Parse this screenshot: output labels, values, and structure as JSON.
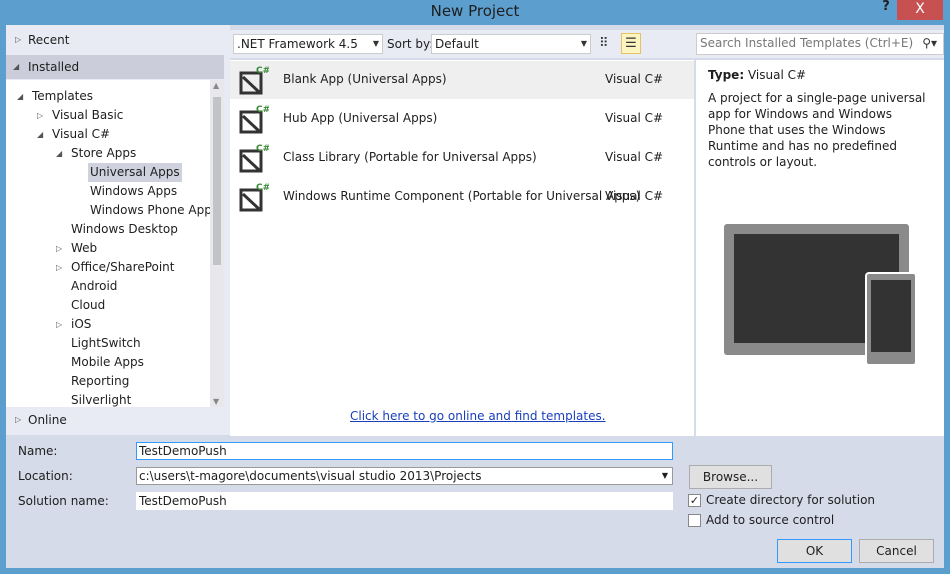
{
  "window": {
    "title": "New Project",
    "help_label": "?",
    "close_label": "X"
  },
  "left": {
    "recent": "Recent",
    "installed": "Installed",
    "online": "Online",
    "tree": [
      {
        "label": "Templates",
        "expander": "expanded"
      },
      {
        "label": "Visual Basic",
        "expander": "collapsed"
      },
      {
        "label": "Visual C#",
        "expander": "expanded"
      },
      {
        "label": "Store Apps",
        "expander": "expanded"
      },
      {
        "label": "Universal Apps",
        "selected": true
      },
      {
        "label": "Windows Apps"
      },
      {
        "label": "Windows Phone Apps"
      },
      {
        "label": "Windows Desktop"
      },
      {
        "label": "Web",
        "expander": "collapsed"
      },
      {
        "label": "Office/SharePoint",
        "expander": "collapsed"
      },
      {
        "label": "Android"
      },
      {
        "label": "Cloud"
      },
      {
        "label": "iOS",
        "expander": "collapsed"
      },
      {
        "label": "LightSwitch"
      },
      {
        "label": "Mobile Apps"
      },
      {
        "label": "Reporting"
      },
      {
        "label": "Silverlight"
      }
    ]
  },
  "toolbar": {
    "framework": ".NET Framework 4.5",
    "sort_label": "Sort by:",
    "sort_value": "Default",
    "search_placeholder": "Search Installed Templates (Ctrl+E)"
  },
  "templates": [
    {
      "name": "Blank App (Universal Apps)",
      "lang": "Visual C#",
      "selected": true
    },
    {
      "name": "Hub App (Universal Apps)",
      "lang": "Visual C#"
    },
    {
      "name": "Class Library (Portable for Universal Apps)",
      "lang": "Visual C#"
    },
    {
      "name": "Windows Runtime Component (Portable for Universal Apps)",
      "lang": "Visual C#"
    }
  ],
  "online_link": "Click here to go online and find templates.",
  "details": {
    "type_label": "Type:",
    "type_value": "Visual C#",
    "description": "A project for a single-page universal app for Windows and Windows Phone that uses the Windows Runtime and has no predefined controls or layout."
  },
  "form": {
    "name_label": "Name:",
    "name_value": "TestDemoPush",
    "location_label": "Location:",
    "location_value": "c:\\users\\t-magore\\documents\\visual studio 2013\\Projects",
    "solution_label": "Solution name:",
    "solution_value": "TestDemoPush",
    "browse": "Browse...",
    "create_dir": "Create directory for solution",
    "create_dir_checked": true,
    "source_control": "Add to source control",
    "source_control_checked": false,
    "ok": "OK",
    "cancel": "Cancel"
  }
}
